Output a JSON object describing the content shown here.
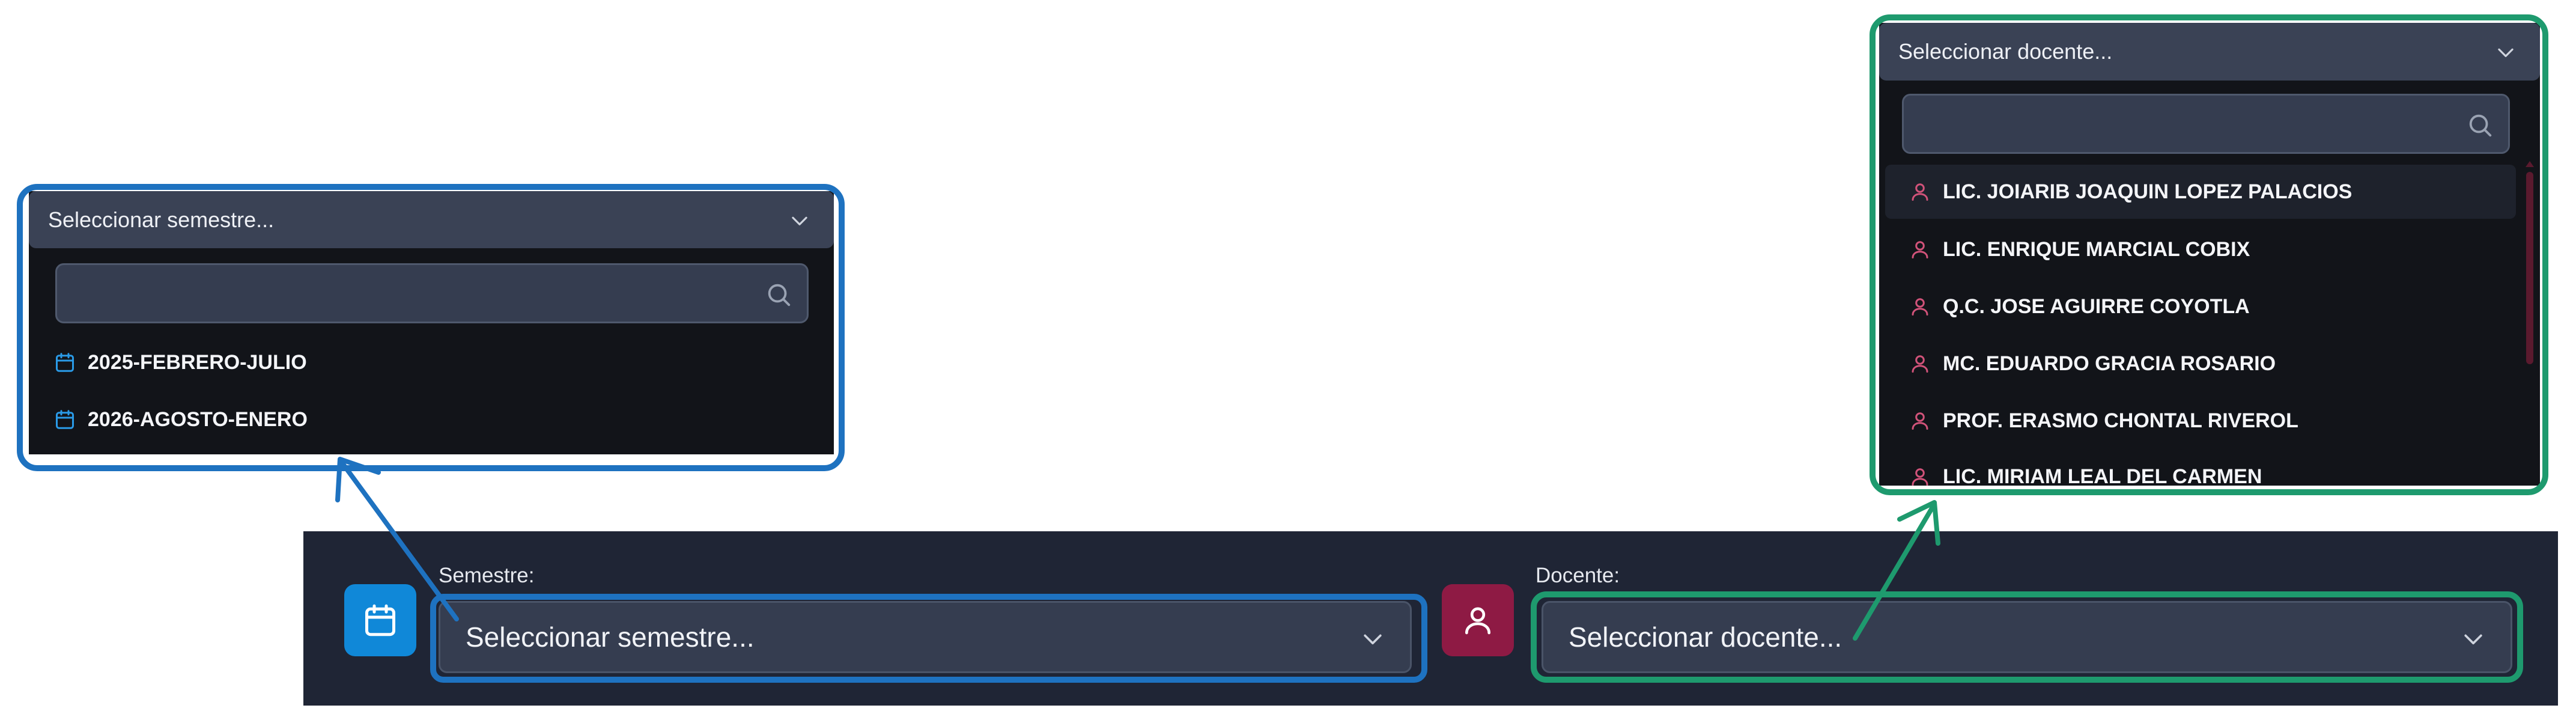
{
  "colors": {
    "toolbar_bg": "#1f2535",
    "semestre_icon_bg": "#1088d8",
    "docente_icon_bg": "#8e1a44",
    "highlight_blue": "#1e72c0",
    "highlight_green": "#1e9a6e",
    "option_icon_blue": "#2a9be8",
    "option_icon_pink": "#d2537a"
  },
  "toolbar": {
    "semestre": {
      "label": "Semestre:",
      "icon": "calendar-icon",
      "placeholder": "Seleccionar semestre..."
    },
    "docente": {
      "label": "Docente:",
      "icon": "user-icon",
      "placeholder": "Seleccionar docente..."
    }
  },
  "semestre_dropdown": {
    "header": "Seleccionar semestre...",
    "search_value": "",
    "option_icon": "calendar-icon",
    "options": [
      {
        "label": "2025-FEBRERO-JULIO"
      },
      {
        "label": "2026-AGOSTO-ENERO"
      }
    ]
  },
  "docente_dropdown": {
    "header": "Seleccionar docente...",
    "search_value": "",
    "option_icon": "user-icon",
    "options": [
      {
        "label": "LIC. JOIARIB JOAQUIN LOPEZ PALACIOS"
      },
      {
        "label": "LIC. ENRIQUE MARCIAL COBIX"
      },
      {
        "label": "Q.C. JOSE AGUIRRE COYOTLA"
      },
      {
        "label": "MC. EDUARDO GRACIA ROSARIO"
      },
      {
        "label": "PROF. ERASMO CHONTAL RIVEROL"
      },
      {
        "label": "LIC. MIRIAM LEAL DEL CARMEN"
      }
    ]
  }
}
